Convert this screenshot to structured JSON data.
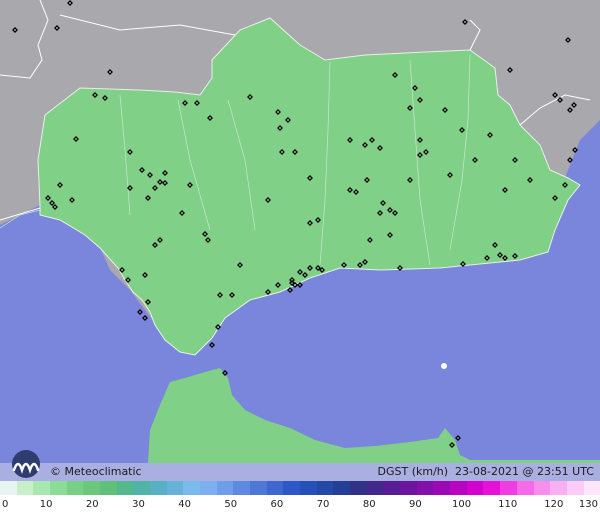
{
  "map": {
    "credit": "© Meteoclimatic",
    "variable": "DGST",
    "unit": "(km/h)",
    "date": "23-08-2021",
    "time_sep": "@",
    "time": "23:51 UTC",
    "legend_ticks": [
      "0",
      "10",
      "20",
      "30",
      "40",
      "50",
      "60",
      "70",
      "80",
      "90",
      "100",
      "110",
      "120",
      "130"
    ],
    "legend_colors": [
      "#e6f5ef",
      "#c8eecb",
      "#a9e6b0",
      "#8bdc97",
      "#78d088",
      "#6cc67c",
      "#5ec07a",
      "#54b88e",
      "#4fb3a8",
      "#58b0c2",
      "#66b2d8",
      "#78bbec",
      "#7eb0f0",
      "#6e9ee8",
      "#5d8ae0",
      "#4f78d6",
      "#3f67cf",
      "#2d59c8",
      "#2450b7",
      "#2348a6",
      "#263f96",
      "#313287",
      "#42288a",
      "#581d94",
      "#6e15a0",
      "#8410ab",
      "#9b09b5",
      "#b705c2",
      "#d202cf",
      "#e810d8",
      "#f03de2",
      "#f46ae9",
      "#f78eee",
      "#f9b0f2",
      "#fbcdf6",
      "#fde6fa"
    ],
    "colors": {
      "sea": "#7a86dc",
      "land": "#7fd087",
      "terrain": "#a9a9ad"
    }
  }
}
